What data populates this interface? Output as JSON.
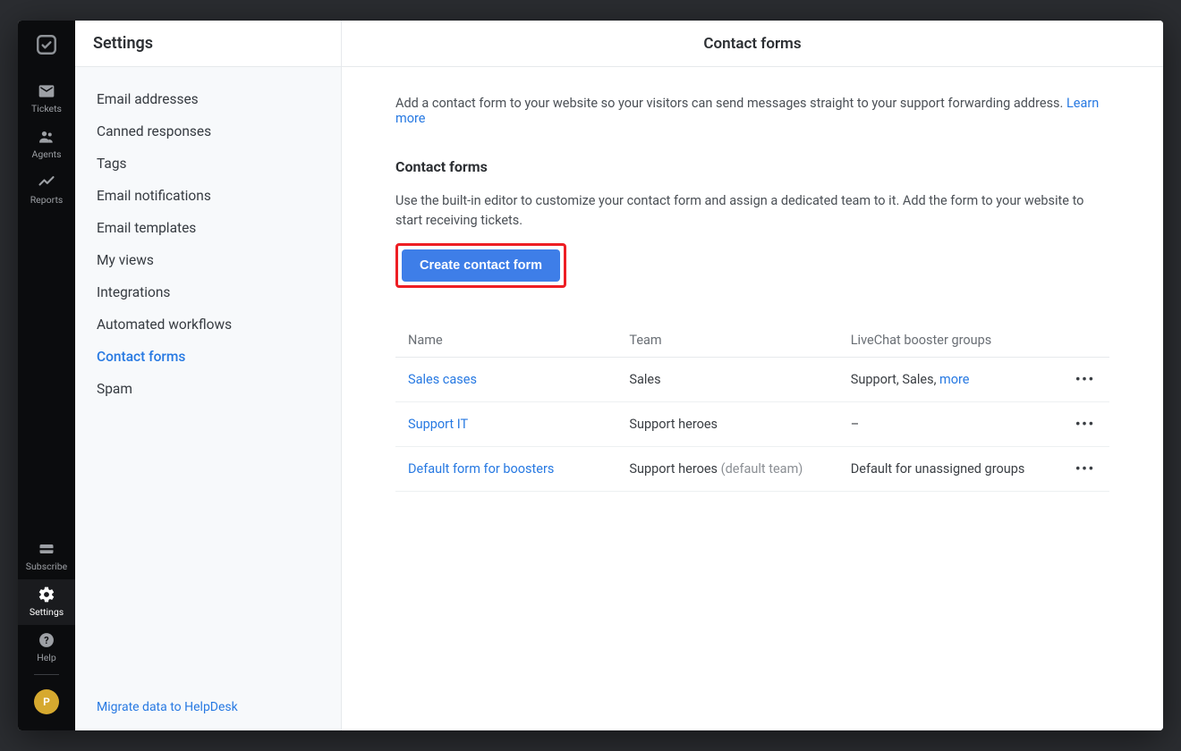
{
  "rail": {
    "tickets": "Tickets",
    "agents": "Agents",
    "reports": "Reports",
    "subscribe": "Subscribe",
    "settings": "Settings",
    "help": "Help",
    "avatar_initial": "P"
  },
  "sidebar": {
    "title": "Settings",
    "items": [
      "Email addresses",
      "Canned responses",
      "Tags",
      "Email notifications",
      "Email templates",
      "My views",
      "Integrations",
      "Automated workflows",
      "Contact forms",
      "Spam"
    ],
    "active_index": 8,
    "footer_link": "Migrate data to HelpDesk"
  },
  "main": {
    "title": "Contact forms",
    "intro_text": "Add a contact form to your website so your visitors can send messages straight to your support forwarding address. ",
    "intro_link": "Learn more",
    "section_title": "Contact forms",
    "section_desc": "Use the built-in editor to customize your contact form and assign a dedicated team to it. Add the form to your website to start receiving tickets.",
    "create_button": "Create contact form",
    "columns": {
      "name": "Name",
      "team": "Team",
      "groups": "LiveChat booster groups"
    },
    "rows": [
      {
        "name": "Sales cases",
        "team": "Sales",
        "team_suffix": "",
        "groups": "Support, Sales, ",
        "groups_more": "more"
      },
      {
        "name": "Support IT",
        "team": "Support heroes",
        "team_suffix": "",
        "groups": "–",
        "groups_more": ""
      },
      {
        "name": "Default form for boosters",
        "team": "Support heroes",
        "team_suffix": " (default team)",
        "groups": "Default for unassigned groups",
        "groups_more": ""
      }
    ]
  }
}
